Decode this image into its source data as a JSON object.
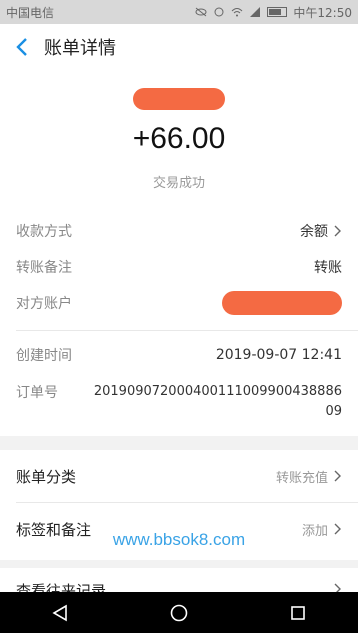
{
  "status_bar": {
    "carrier": "中国电信",
    "time": "中午12:50"
  },
  "header": {
    "title": "账单详情"
  },
  "summary": {
    "amount": "+66.00",
    "status": "交易成功"
  },
  "details": {
    "payment_method_label": "收款方式",
    "payment_method_value": "余额",
    "transfer_note_label": "转账备注",
    "transfer_note_value": "转账",
    "counterparty_label": "对方账户",
    "created_time_label": "创建时间",
    "created_time_value": "2019-09-07 12:41",
    "order_no_label": "订单号",
    "order_no_value": "201909072000400111009900438886 09"
  },
  "category": {
    "bill_category_label": "账单分类",
    "bill_category_value": "转账充值",
    "tags_notes_label": "标签和备注",
    "tags_notes_value": "添加"
  },
  "history": {
    "label": "查看往来记录"
  },
  "watermark": "www.bbsok8.com",
  "colors": {
    "accent": "#1a8fe3",
    "redaction": "#f46a43",
    "watermark": "#3aa3e6"
  }
}
